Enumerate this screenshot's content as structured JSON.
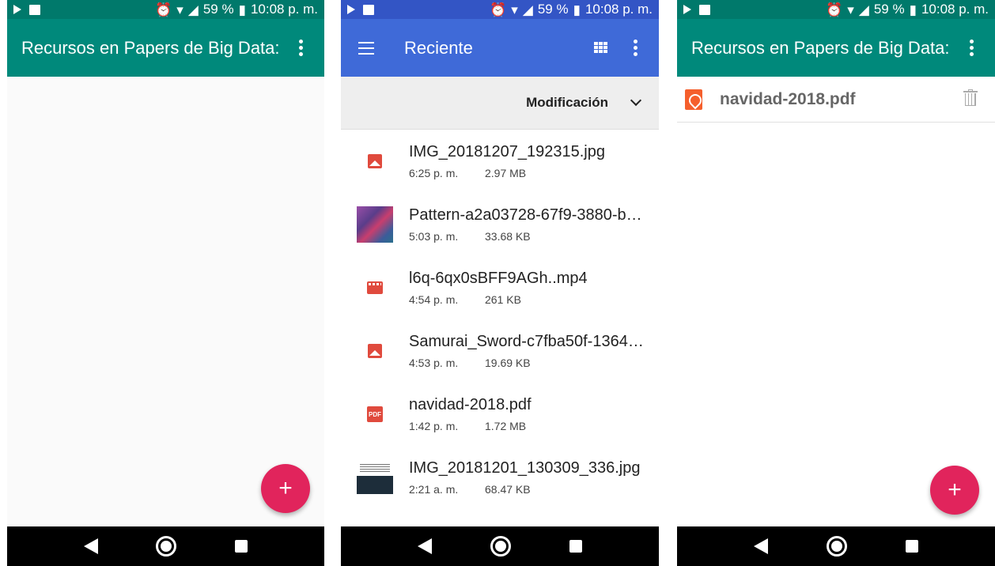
{
  "colors": {
    "teal_appbar": "#00897b",
    "teal_status": "#00796b",
    "blue_appbar": "#3f6ad8",
    "blue_status": "#3355c5",
    "fab": "#e1245c",
    "file_icon_red": "#e04a3d",
    "pdf_orange": "#f55f2c"
  },
  "status": {
    "battery": "59 %",
    "time": "10:08 p. m."
  },
  "screen1": {
    "title": "Recursos en Papers de Big Data:",
    "fab_label": "+"
  },
  "screen2": {
    "title": "Reciente",
    "sort_label": "Modificación",
    "files": [
      {
        "name": "IMG_20181207_192315.jpg",
        "time": "6:25 p. m.",
        "size": "2.97 MB",
        "icon": "image-icon"
      },
      {
        "name": "Pattern-a2a03728-67f9-3880-b…",
        "time": "5:03 p. m.",
        "size": "33.68 KB",
        "icon": "pattern-thumbnail"
      },
      {
        "name": "l6q-6qx0sBFF9AGh..mp4",
        "time": "4:54 p. m.",
        "size": "261 KB",
        "icon": "video-icon"
      },
      {
        "name": "Samurai_Sword-c7fba50f-1364…",
        "time": "4:53 p. m.",
        "size": "19.69 KB",
        "icon": "image-icon"
      },
      {
        "name": "navidad-2018.pdf",
        "time": "1:42 p. m.",
        "size": "1.72 MB",
        "icon": "pdf-icon"
      },
      {
        "name": "IMG_20181201_130309_336.jpg",
        "time": "2:21 a. m.",
        "size": "68.47 KB",
        "icon": "movie-thumbnail"
      }
    ]
  },
  "screen3": {
    "title": "Recursos en Papers de Big Data:",
    "item_name": "navidad-2018.pdf",
    "fab_label": "+"
  }
}
